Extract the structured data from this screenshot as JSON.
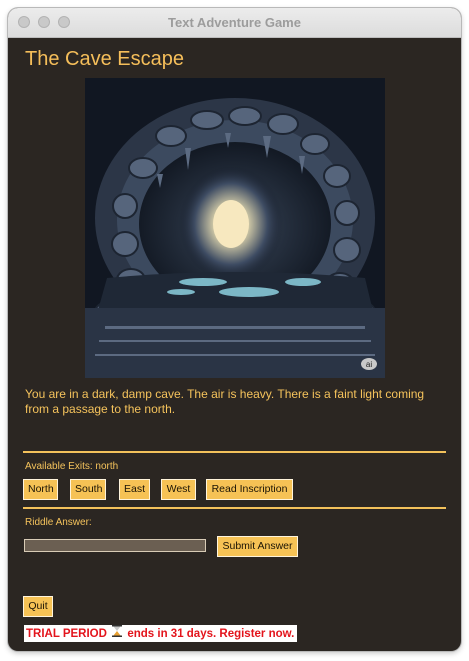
{
  "window": {
    "title": "Text Adventure Game"
  },
  "game": {
    "title": "The Cave Escape",
    "scene_badge": "ai",
    "description": "You are in a dark, damp cave. The air is heavy. There is a faint light coming from a passage to the north."
  },
  "exits": {
    "label": "Available Exits: north",
    "buttons": [
      "North",
      "South",
      "East",
      "West",
      "Read Inscription"
    ]
  },
  "riddle": {
    "label": "Riddle Answer:",
    "value": "",
    "submit_label": "Submit Answer"
  },
  "footer": {
    "quit_label": "Quit",
    "trial_prefix": "TRIAL PERIOD",
    "trial_suffix": "ends in 31 days. Register now.",
    "trial_icon": "hourglass-icon"
  },
  "colors": {
    "background": "#2b2622",
    "accent": "#f5be5a",
    "button": "#f6c255",
    "trial_text": "#e3141c"
  }
}
